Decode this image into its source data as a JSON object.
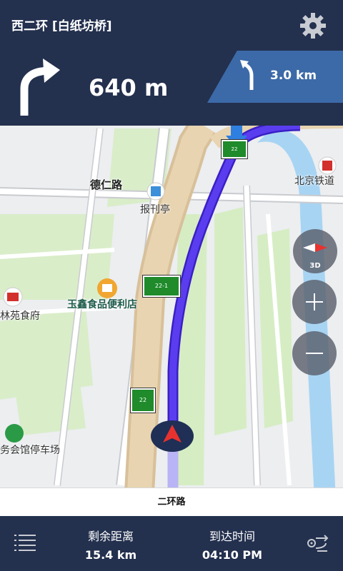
{
  "header": {
    "street": "西二环 [白纸坊桥]",
    "distance": "640 m",
    "next_distance": "3.0 km"
  },
  "map": {
    "labels": {
      "deren_road": "德仁路",
      "newsstand": "报刊亭",
      "yuxin_store": "玉鑫食品便利店",
      "linyuan": "林苑食府",
      "parking": "务会馆停车场",
      "railway": "北京铁道"
    },
    "signs": {
      "sign_a": "22-1",
      "sign_b": "22",
      "sign_c": "22"
    },
    "view_mode": "3D"
  },
  "road_label": "二环路",
  "footer": {
    "remaining_label": "剩余距离",
    "remaining_value": "15.4 km",
    "arrival_label": "到达时间",
    "arrival_value": "04:10 PM"
  },
  "colors": {
    "panel": "#23304e",
    "next_panel": "#3c6aa8",
    "route": "#4f2fe3"
  }
}
